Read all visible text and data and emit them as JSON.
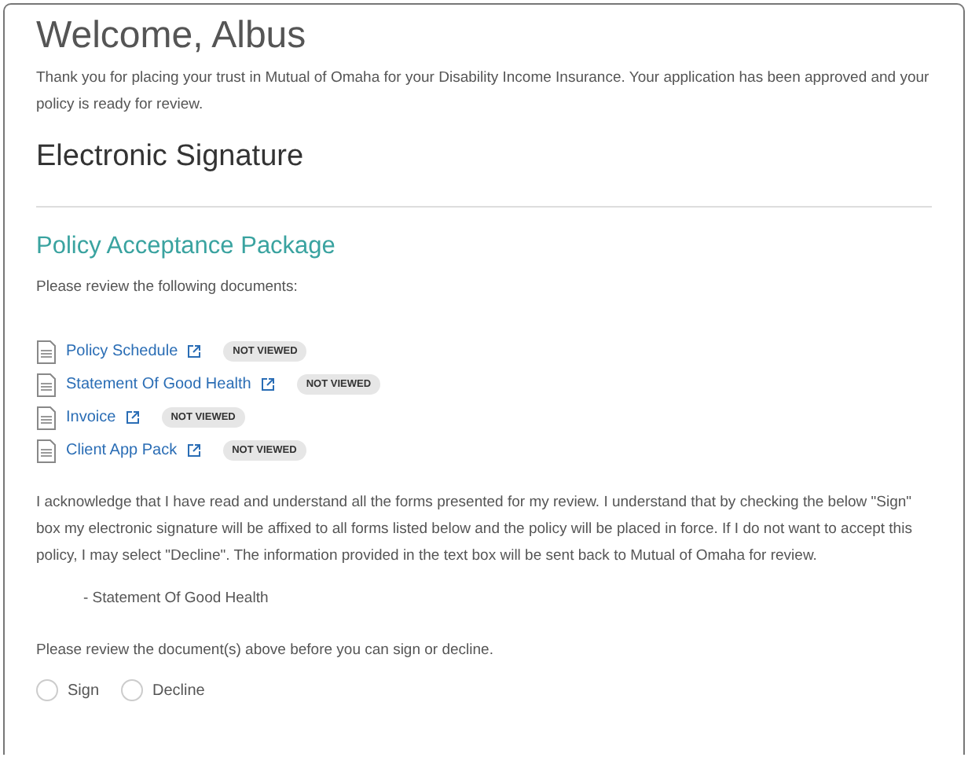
{
  "title": "Welcome, Albus",
  "intro": "Thank you for placing your trust in Mutual of Omaha for your Disability Income Insurance. Your application has been approved and your policy is ready for review.",
  "signature_heading": "Electronic Signature",
  "package": {
    "heading": "Policy Acceptance Package",
    "instruction": "Please review the following documents:",
    "documents": [
      {
        "name": "Policy Schedule",
        "status": "NOT VIEWED"
      },
      {
        "name": "Statement Of Good Health",
        "status": "NOT VIEWED"
      },
      {
        "name": "Invoice",
        "status": "NOT VIEWED"
      },
      {
        "name": "Client App Pack",
        "status": "NOT VIEWED"
      }
    ]
  },
  "acknowledgement": "I acknowledge that I have read and understand all the forms presented for my review. I understand that by checking the below \"Sign\" box my electronic signature will be affixed to all forms listed below and the policy will be placed in force. If I do not want to accept this policy, I may select \"Decline\". The information provided in the text box will be sent back to Mutual of Omaha for review.",
  "pending_documents": [
    "- Statement Of Good Health"
  ],
  "review_notice": "Please review the document(s) above before you can sign or decline.",
  "options": [
    {
      "label": "Sign",
      "selected": false
    },
    {
      "label": "Decline",
      "selected": false
    }
  ]
}
